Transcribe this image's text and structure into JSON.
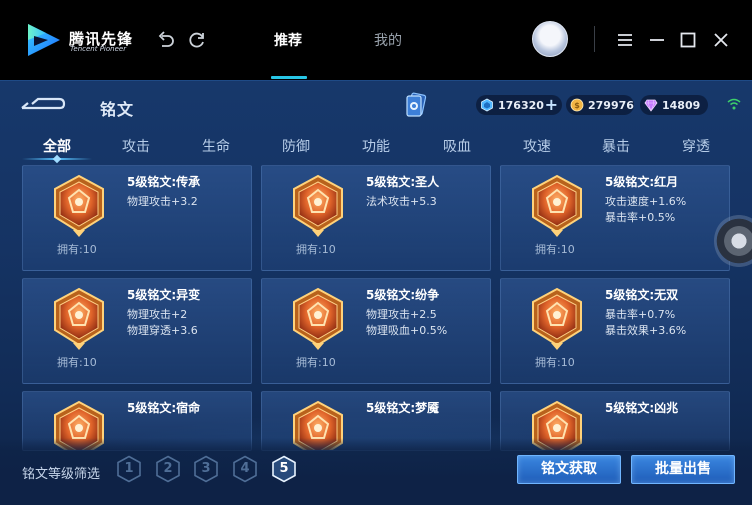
{
  "app": {
    "brand_cn": "腾讯先锋",
    "brand_en": "Tencent Pioneer"
  },
  "nav": {
    "tabs": [
      {
        "label": "推荐",
        "active": true
      },
      {
        "label": "我的",
        "active": false
      }
    ]
  },
  "window_controls": [
    "undo-icon",
    "refresh-icon",
    "menu-icon",
    "minimize-icon",
    "maximize-icon",
    "close-icon"
  ],
  "game": {
    "title": "铭文",
    "currencies": [
      {
        "name": "diamond",
        "value": "176320",
        "color": "#4fb6ff"
      },
      {
        "name": "coin",
        "value": "279976",
        "color": "#f2b544"
      },
      {
        "name": "gem",
        "value": "14809",
        "color": "#c67bff"
      }
    ],
    "tabs": [
      "全部",
      "攻击",
      "生命",
      "防御",
      "功能",
      "吸血",
      "攻速",
      "暴击",
      "穿透"
    ],
    "active_tab": "全部",
    "runes": [
      {
        "name": "5级铭文:传承",
        "attrs": [
          "物理攻击+3.2"
        ],
        "owned": "拥有:10"
      },
      {
        "name": "5级铭文:圣人",
        "attrs": [
          "法术攻击+5.3"
        ],
        "owned": "拥有:10"
      },
      {
        "name": "5级铭文:红月",
        "attrs": [
          "攻击速度+1.6%",
          "暴击率+0.5%"
        ],
        "owned": "拥有:10"
      },
      {
        "name": "5级铭文:异变",
        "attrs": [
          "物理攻击+2",
          "物理穿透+3.6"
        ],
        "owned": "拥有:10"
      },
      {
        "name": "5级铭文:纷争",
        "attrs": [
          "物理攻击+2.5",
          "物理吸血+0.5%"
        ],
        "owned": "拥有:10"
      },
      {
        "name": "5级铭文:无双",
        "attrs": [
          "暴击率+0.7%",
          "暴击效果+3.6%"
        ],
        "owned": "拥有:10"
      },
      {
        "name": "5级铭文:宿命",
        "attrs": [],
        "owned": ""
      },
      {
        "name": "5级铭文:梦魇",
        "attrs": [],
        "owned": ""
      },
      {
        "name": "5级铭文:凶兆",
        "attrs": [],
        "owned": ""
      }
    ],
    "filter_label": "铭文等级筛选",
    "levels": [
      "1",
      "2",
      "3",
      "4",
      "5"
    ],
    "selected_level": "5",
    "buttons": {
      "acquire": "铭文获取",
      "bulk_sell": "批量出售"
    }
  }
}
